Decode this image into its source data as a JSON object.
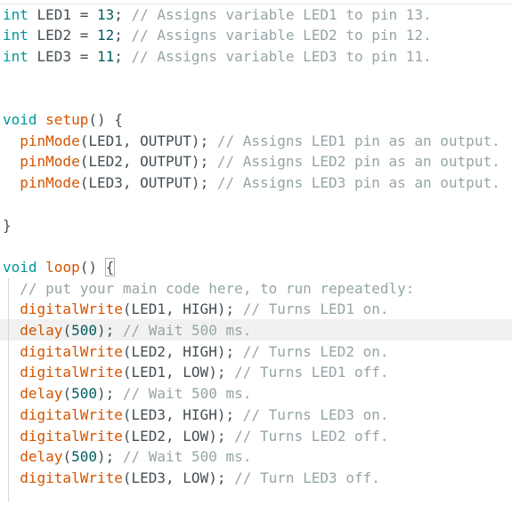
{
  "editor": {
    "lines": [
      {
        "tokens": [
          {
            "t": "int",
            "c": "kw-type"
          },
          {
            "t": " LED1 = ",
            "c": "ident"
          },
          {
            "t": "13",
            "c": "num"
          },
          {
            "t": "; ",
            "c": "punct"
          },
          {
            "t": "// Assigns variable LED1 to pin 13.",
            "c": "comment"
          }
        ]
      },
      {
        "tokens": [
          {
            "t": "int",
            "c": "kw-type"
          },
          {
            "t": " LED2 = ",
            "c": "ident"
          },
          {
            "t": "12",
            "c": "num"
          },
          {
            "t": "; ",
            "c": "punct"
          },
          {
            "t": "// Assigns variable LED2 to pin 12.",
            "c": "comment"
          }
        ]
      },
      {
        "tokens": [
          {
            "t": "int",
            "c": "kw-type"
          },
          {
            "t": " LED3 = ",
            "c": "ident"
          },
          {
            "t": "11",
            "c": "num"
          },
          {
            "t": "; ",
            "c": "punct"
          },
          {
            "t": "// Assigns variable LED3 to pin 11.",
            "c": "comment"
          }
        ]
      },
      {
        "tokens": []
      },
      {
        "tokens": []
      },
      {
        "tokens": [
          {
            "t": "void",
            "c": "kw-type"
          },
          {
            "t": " ",
            "c": "ident"
          },
          {
            "t": "setup",
            "c": "kw-func"
          },
          {
            "t": "() {",
            "c": "punct"
          }
        ]
      },
      {
        "tokens": [
          {
            "t": "  ",
            "c": "ident"
          },
          {
            "t": "pinMode",
            "c": "kw-func"
          },
          {
            "t": "(LED1, OUTPUT); ",
            "c": "ident"
          },
          {
            "t": "// Assigns LED1 pin as an output.",
            "c": "comment"
          }
        ]
      },
      {
        "tokens": [
          {
            "t": "  ",
            "c": "ident"
          },
          {
            "t": "pinMode",
            "c": "kw-func"
          },
          {
            "t": "(LED2, OUTPUT); ",
            "c": "ident"
          },
          {
            "t": "// Assigns LED2 pin as an output.",
            "c": "comment"
          }
        ]
      },
      {
        "tokens": [
          {
            "t": "  ",
            "c": "ident"
          },
          {
            "t": "pinMode",
            "c": "kw-func"
          },
          {
            "t": "(LED3, OUTPUT); ",
            "c": "ident"
          },
          {
            "t": "// Assigns LED3 pin as an output.",
            "c": "comment"
          }
        ]
      },
      {
        "tokens": []
      },
      {
        "tokens": [
          {
            "t": "}",
            "c": "punct"
          }
        ]
      },
      {
        "tokens": []
      },
      {
        "tokens": [
          {
            "t": "void",
            "c": "kw-type"
          },
          {
            "t": " ",
            "c": "ident"
          },
          {
            "t": "loop",
            "c": "kw-func"
          },
          {
            "t": "() ",
            "c": "punct"
          },
          {
            "t": "{",
            "c": "punct bracket-match"
          }
        ]
      },
      {
        "tokens": [
          {
            "t": "  ",
            "c": "ident"
          },
          {
            "t": "// put your main code here, to run repeatedly:",
            "c": "comment"
          }
        ]
      },
      {
        "tokens": [
          {
            "t": "  ",
            "c": "ident"
          },
          {
            "t": "digitalWrite",
            "c": "kw-func"
          },
          {
            "t": "(LED1, HIGH); ",
            "c": "ident"
          },
          {
            "t": "// Turns LED1 on.",
            "c": "comment"
          }
        ]
      },
      {
        "tokens": [
          {
            "t": "  ",
            "c": "ident"
          },
          {
            "t": "delay",
            "c": "kw-func"
          },
          {
            "t": "(",
            "c": "punct"
          },
          {
            "t": "500",
            "c": "num"
          },
          {
            "t": "); ",
            "c": "punct"
          },
          {
            "t": "// Wait 500 ms.",
            "c": "comment"
          }
        ]
      },
      {
        "tokens": [
          {
            "t": "  ",
            "c": "ident"
          },
          {
            "t": "digitalWrite",
            "c": "kw-func"
          },
          {
            "t": "(LED2, HIGH); ",
            "c": "ident"
          },
          {
            "t": "// Turns LED2 on.",
            "c": "comment"
          }
        ]
      },
      {
        "tokens": [
          {
            "t": "  ",
            "c": "ident"
          },
          {
            "t": "digitalWrite",
            "c": "kw-func"
          },
          {
            "t": "(LED1, LOW); ",
            "c": "ident"
          },
          {
            "t": "// Turns LED1 off.",
            "c": "comment"
          }
        ]
      },
      {
        "tokens": [
          {
            "t": "  ",
            "c": "ident"
          },
          {
            "t": "delay",
            "c": "kw-func"
          },
          {
            "t": "(",
            "c": "punct"
          },
          {
            "t": "500",
            "c": "num"
          },
          {
            "t": "); ",
            "c": "punct"
          },
          {
            "t": "// Wait 500 ms.",
            "c": "comment"
          }
        ]
      },
      {
        "tokens": [
          {
            "t": "  ",
            "c": "ident"
          },
          {
            "t": "digitalWrite",
            "c": "kw-func"
          },
          {
            "t": "(LED3, HIGH); ",
            "c": "ident"
          },
          {
            "t": "// Turns LED3 on.",
            "c": "comment"
          }
        ]
      },
      {
        "tokens": [
          {
            "t": "  ",
            "c": "ident"
          },
          {
            "t": "digitalWrite",
            "c": "kw-func"
          },
          {
            "t": "(LED2, LOW); ",
            "c": "ident"
          },
          {
            "t": "// Turns LED2 off.",
            "c": "comment"
          }
        ]
      },
      {
        "tokens": [
          {
            "t": "  ",
            "c": "ident"
          },
          {
            "t": "delay",
            "c": "kw-func"
          },
          {
            "t": "(",
            "c": "punct"
          },
          {
            "t": "500",
            "c": "num"
          },
          {
            "t": "); ",
            "c": "punct"
          },
          {
            "t": "// Wait 500 ms.",
            "c": "comment"
          }
        ]
      },
      {
        "tokens": [
          {
            "t": "  ",
            "c": "ident"
          },
          {
            "t": "digitalWrite",
            "c": "kw-func"
          },
          {
            "t": "(LED3, LOW); ",
            "c": "ident"
          },
          {
            "t": "// Turn LED3 off.",
            "c": "comment"
          }
        ]
      }
    ],
    "current_line_index": 15,
    "colors": {
      "type_keyword": "#00979c",
      "function": "#d35400",
      "number": "#005c5f",
      "comment": "#95a5a6",
      "text": "#434f54",
      "current_line": "#f1f1f1"
    }
  }
}
